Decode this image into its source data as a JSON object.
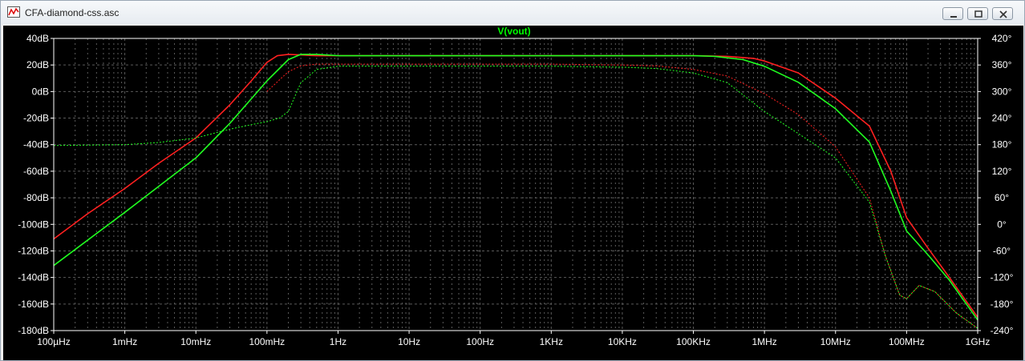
{
  "window": {
    "title": "CFA-diamond-css.asc",
    "icons": [
      "waveform-icon",
      "minimize-icon",
      "restore-icon",
      "close-icon"
    ]
  },
  "chart_data": {
    "type": "line",
    "title": "V(vout)",
    "xscale": "log",
    "xlim": [
      0.0001,
      1000000000
    ],
    "x_ticks": [
      "100µHz",
      "1mHz",
      "10mHz",
      "100mHz",
      "1Hz",
      "10Hz",
      "100Hz",
      "1KHz",
      "10KHz",
      "100KHz",
      "1MHz",
      "10MHz",
      "100MHz",
      "1GHz"
    ],
    "ylim_left": [
      -180,
      40
    ],
    "y_left_ticks": [
      "40dB",
      "20dB",
      "0dB",
      "-20dB",
      "-40dB",
      "-60dB",
      "-80dB",
      "-100dB",
      "-120dB",
      "-140dB",
      "-160dB",
      "-180dB"
    ],
    "ylim_right": [
      -240,
      420
    ],
    "y_right_ticks": [
      "420°",
      "360°",
      "300°",
      "240°",
      "180°",
      "120°",
      "60°",
      "0°",
      "-60°",
      "-120°",
      "-180°",
      "-240°"
    ],
    "grid": true,
    "colors": {
      "title": "#00ff00",
      "red": "#ff2020",
      "green": "#20ff20",
      "axis": "#ffffff",
      "grid": "#5a5a5a"
    },
    "series": [
      {
        "color": "red",
        "style": "solid",
        "axis": "magnitude",
        "x": [
          0.0001,
          0.0003,
          0.001,
          0.003,
          0.01,
          0.03,
          0.06,
          0.1,
          0.14,
          0.2,
          0.5,
          1,
          10,
          100,
          1000,
          10000,
          100000,
          300000,
          700000,
          1000000,
          3000000,
          10000000,
          30000000,
          60000000,
          100000000,
          200000000,
          400000000,
          1000000000
        ],
        "y": [
          -111,
          -92,
          -73,
          -54,
          -35,
          -10,
          8,
          22,
          27,
          28,
          27,
          27,
          27,
          27,
          27,
          27,
          27,
          26.5,
          25,
          23,
          14,
          -5,
          -26,
          -60,
          -95,
          -118,
          -140,
          -170
        ]
      },
      {
        "color": "green",
        "style": "solid",
        "axis": "magnitude",
        "x": [
          0.0001,
          0.001,
          0.01,
          0.03,
          0.1,
          0.2,
          0.3,
          0.5,
          1,
          10,
          100,
          1000,
          10000,
          100000,
          200000,
          500000,
          1000000,
          3000000,
          10000000,
          30000000,
          60000000,
          100000000,
          200000000,
          400000000,
          1000000000
        ],
        "y": [
          -131,
          -91,
          -50,
          -24,
          8,
          24,
          28,
          28,
          27,
          27,
          27,
          27,
          27,
          27,
          26.5,
          24,
          19,
          7,
          -13,
          -38,
          -75,
          -105,
          -123,
          -142,
          -172
        ]
      },
      {
        "color": "red",
        "style": "dotted",
        "axis": "phase",
        "x": [
          0.1,
          0.2,
          0.3,
          0.5,
          1,
          10,
          100,
          1000,
          10000,
          30000,
          100000,
          300000,
          1000000,
          3000000,
          10000000,
          30000000,
          50000000,
          80000000,
          100000000,
          150000000,
          250000000,
          500000000,
          1000000000
        ],
        "y": [
          300,
          345,
          358,
          362,
          362,
          362,
          362,
          362,
          360,
          358,
          350,
          335,
          295,
          248,
          175,
          60,
          -70,
          -160,
          -168,
          -138,
          -152,
          -200,
          -235
        ]
      },
      {
        "color": "green",
        "style": "dotted",
        "axis": "phase",
        "x": [
          0.0001,
          0.001,
          0.003,
          0.01,
          0.03,
          0.06,
          0.1,
          0.15,
          0.2,
          0.3,
          0.5,
          1,
          10,
          100,
          1000,
          10000,
          30000,
          100000,
          300000,
          1000000,
          3000000,
          10000000,
          30000000,
          50000000,
          80000000,
          100000000,
          150000000,
          250000000,
          500000000,
          1000000000
        ],
        "y": [
          178,
          180,
          185,
          195,
          215,
          225,
          232,
          240,
          255,
          320,
          350,
          357,
          357,
          357,
          357,
          355,
          352,
          342,
          320,
          255,
          205,
          150,
          50,
          -70,
          -160,
          -168,
          -138,
          -152,
          -200,
          -235
        ]
      }
    ]
  }
}
